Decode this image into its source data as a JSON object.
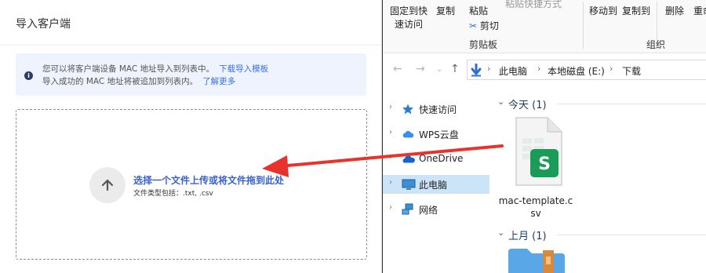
{
  "dialog": {
    "title": "导入客户端",
    "notice": {
      "line1": "您可以将客户端设备 MAC 地址导入到列表中。",
      "link1": "下载导入模板",
      "line2": "导入成功的 MAC 地址将被追加到列表内。",
      "link2": "了解更多"
    },
    "upload": {
      "title": "选择一个文件上传或将文件拖到此处",
      "subtitle": "文件类型包括：.txt, .csv"
    }
  },
  "explorer": {
    "ribbon": {
      "pin_line1": "固定到快",
      "pin_line2": "速访问",
      "copy": "复制",
      "paste": "粘贴",
      "cut": "剪切",
      "copy_path": "粘贴快捷方式",
      "clipboard_group": "剪贴板",
      "move_to": "移动到",
      "copy_to": "复制到",
      "delete": "删除",
      "rename": "重命",
      "organize_group": "组织"
    },
    "breadcrumb": [
      "此电脑",
      "本地磁盘 (E:)",
      "下载"
    ],
    "sidebar": [
      {
        "label": "快速访问",
        "icon": "star-icon"
      },
      {
        "label": "WPS云盘",
        "icon": "cloud-icon"
      },
      {
        "label": "OneDrive",
        "icon": "onedrive-icon"
      },
      {
        "label": "此电脑",
        "icon": "computer-icon",
        "selected": true
      },
      {
        "label": "网络",
        "icon": "network-icon"
      }
    ],
    "groups": [
      {
        "label": "今天 (1)"
      },
      {
        "label": "上月 (1)"
      }
    ],
    "file": {
      "name": "mac-template.csv",
      "icon_letter": "S"
    }
  }
}
